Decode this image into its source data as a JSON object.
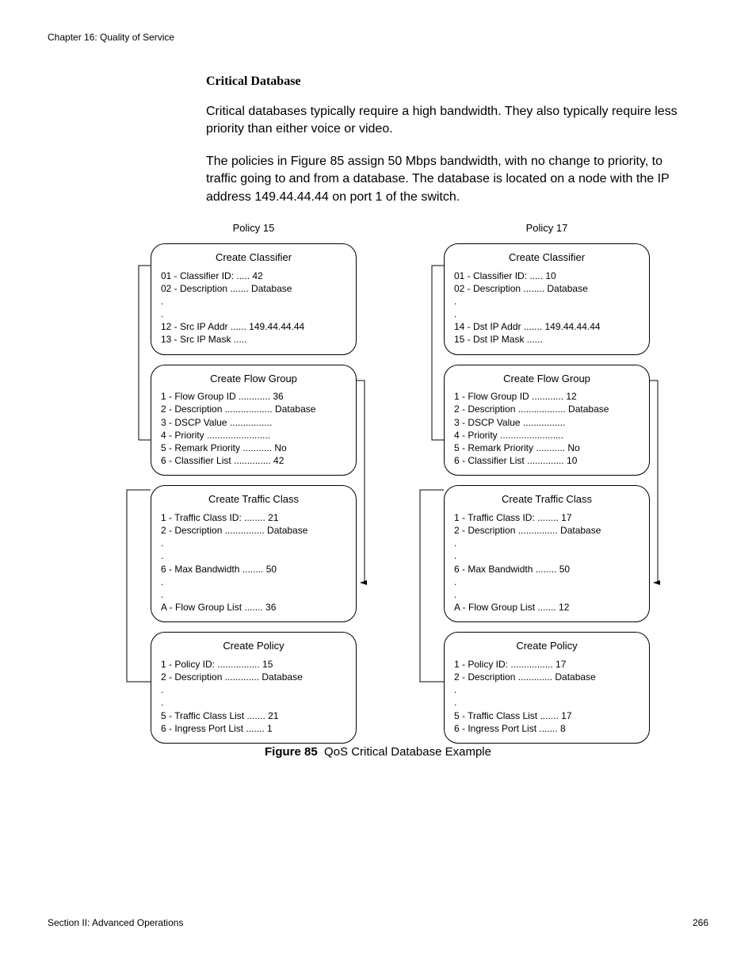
{
  "header": "Chapter 16: Quality of Service",
  "section_title": "Critical Database",
  "para1": "Critical databases typically require a high bandwidth. They also typically require less priority than either voice or video.",
  "para2": "The policies in Figure 85 assign 50 Mbps bandwidth, with no change to priority, to traffic going to and from a database. The database is located on a node with the IP address 149.44.44.44 on port 1 of the switch.",
  "figure": {
    "caption_label": "Figure 85",
    "caption_text": "QoS Critical Database Example",
    "left": {
      "title": "Policy 15",
      "classifier": {
        "title": "Create Classifier",
        "rows": [
          "01 - Classifier ID: ..... 42",
          "02 - Description ....... Database",
          ".",
          ".",
          "12 - Src IP Addr ...... 149.44.44.44",
          "13 - Src IP Mask ....."
        ]
      },
      "flowgroup": {
        "title": "Create Flow Group",
        "rows": [
          "1 - Flow Group ID ............ 36",
          "2 - Description .................. Database",
          "3 - DSCP Value ................",
          "4 - Priority ........................",
          "5 - Remark Priority ........... No",
          "6 - Classifier List .............. 42"
        ]
      },
      "traffic": {
        "title": "Create Traffic Class",
        "rows": [
          "1 - Traffic Class ID: ........ 21",
          "2 - Description ............... Database",
          ".",
          ".",
          "6 - Max Bandwidth ........ 50",
          ".",
          ".",
          "A - Flow Group List ....... 36"
        ]
      },
      "policy": {
        "title": "Create Policy",
        "rows": [
          "1 - Policy ID: ................ 15",
          "2 - Description ............. Database",
          ".",
          ".",
          "5 - Traffic Class List ....... 21",
          "6 - Ingress Port List ....... 1"
        ]
      }
    },
    "right": {
      "title": "Policy 17",
      "classifier": {
        "title": "Create Classifier",
        "rows": [
          "01 - Classifier ID: ..... 10",
          "02 - Description ........ Database",
          ".",
          ".",
          "14 - Dst IP Addr ....... 149.44.44.44",
          "15 - Dst IP Mask ......"
        ]
      },
      "flowgroup": {
        "title": "Create Flow Group",
        "rows": [
          "1 - Flow Group ID ............ 12",
          "2 - Description .................. Database",
          "3 - DSCP Value ................",
          "4 - Priority ........................",
          "5 - Remark Priority ........... No",
          "6 - Classifier List .............. 10"
        ]
      },
      "traffic": {
        "title": "Create Traffic Class",
        "rows": [
          "1 - Traffic Class ID: ........ 17",
          "2 - Description ............... Database",
          ".",
          ".",
          "6 - Max Bandwidth ........ 50",
          ".",
          ".",
          "A - Flow Group List ....... 12"
        ]
      },
      "policy": {
        "title": "Create Policy",
        "rows": [
          "1 - Policy ID: ................ 17",
          "2 - Description ............. Database",
          ".",
          ".",
          "5 - Traffic Class List ....... 17",
          "6 - Ingress Port List ....... 8"
        ]
      }
    }
  },
  "footer": {
    "section": "Section II: Advanced Operations",
    "page": "266"
  }
}
